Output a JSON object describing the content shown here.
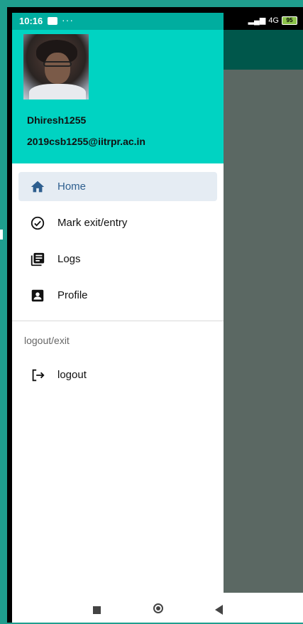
{
  "status_bar": {
    "time": "10:16",
    "dots": "···",
    "network": "4G",
    "battery": "95"
  },
  "drawer": {
    "user": {
      "name": "Dhiresh1255",
      "email": "2019csb1255@iitrpr.ac.in"
    },
    "menu": [
      {
        "label": "Home",
        "icon": "home-icon",
        "active": true
      },
      {
        "label": "Mark exit/entry",
        "icon": "check-circle-icon",
        "active": false
      },
      {
        "label": "Logs",
        "icon": "logs-icon",
        "active": false
      },
      {
        "label": "Profile",
        "icon": "profile-icon",
        "active": false
      }
    ],
    "section_label": "logout/exit",
    "logout_label": "logout"
  },
  "colors": {
    "header": "#00d3c2",
    "toolbar": "#00574b",
    "scrim": "#5b6863",
    "active_text": "#2e5f8f",
    "active_bg": "#e5ecf3"
  }
}
